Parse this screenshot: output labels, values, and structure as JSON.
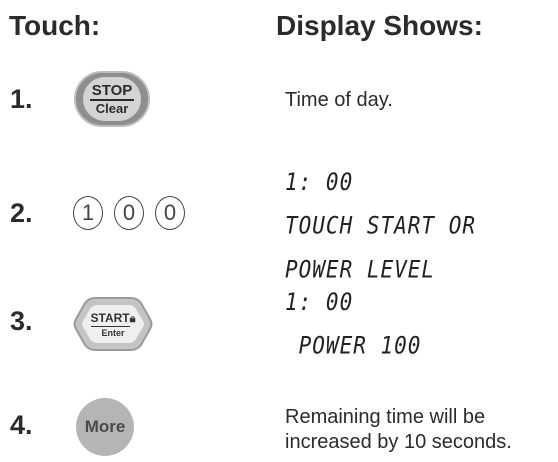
{
  "headers": {
    "touch": "Touch:",
    "display": "Display Shows:"
  },
  "steps": [
    {
      "number": "1.",
      "button": {
        "top": "STOP",
        "bottom": "Clear"
      },
      "display": {
        "text": "Time of day."
      }
    },
    {
      "number": "2.",
      "digits": [
        "1",
        "0",
        "0"
      ],
      "display": {
        "lcd": [
          "1: 00",
          "TOUCH START OR",
          "POWER LEVEL"
        ]
      }
    },
    {
      "number": "3.",
      "button": {
        "top": "START",
        "bottom": "Enter"
      },
      "display": {
        "lcd": [
          "1: 00",
          " POWER 100"
        ]
      }
    },
    {
      "number": "4.",
      "button": {
        "label": "More"
      },
      "display": {
        "lines": [
          "Remaining time will be",
          "increased by 10 seconds."
        ]
      }
    }
  ]
}
